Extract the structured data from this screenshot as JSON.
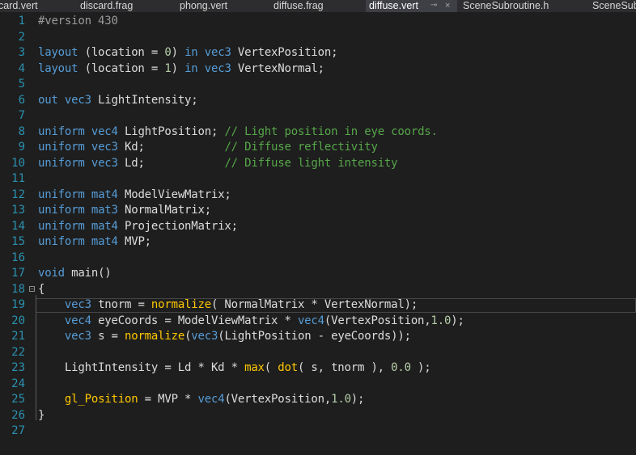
{
  "tabs": [
    {
      "label": "card.vert",
      "active": false
    },
    {
      "label": "discard.frag",
      "active": false
    },
    {
      "label": "phong.vert",
      "active": false
    },
    {
      "label": "diffuse.frag",
      "active": false
    },
    {
      "label": "diffuse.vert",
      "active": true,
      "pin": "⊸",
      "close": "×"
    },
    {
      "label": "SceneSubroutine.h",
      "active": false
    },
    {
      "label": "SceneSub",
      "active": false
    }
  ],
  "editor": {
    "current_line": 19,
    "lines": [
      {
        "n": "1",
        "tokens": [
          {
            "t": "#version 430",
            "c": "pp"
          }
        ]
      },
      {
        "n": "2",
        "tokens": []
      },
      {
        "n": "3",
        "tokens": [
          {
            "t": "layout",
            "c": "kw"
          },
          {
            "t": " (location = ",
            "c": "txt"
          },
          {
            "t": "0",
            "c": "num"
          },
          {
            "t": ") ",
            "c": "txt"
          },
          {
            "t": "in",
            "c": "kw"
          },
          {
            "t": " ",
            "c": "txt"
          },
          {
            "t": "vec3",
            "c": "kw"
          },
          {
            "t": " VertexPosition;",
            "c": "txt"
          }
        ]
      },
      {
        "n": "4",
        "tokens": [
          {
            "t": "layout",
            "c": "kw"
          },
          {
            "t": " (location = ",
            "c": "txt"
          },
          {
            "t": "1",
            "c": "num"
          },
          {
            "t": ") ",
            "c": "txt"
          },
          {
            "t": "in",
            "c": "kw"
          },
          {
            "t": " ",
            "c": "txt"
          },
          {
            "t": "vec3",
            "c": "kw"
          },
          {
            "t": " VertexNormal;",
            "c": "txt"
          }
        ]
      },
      {
        "n": "5",
        "tokens": []
      },
      {
        "n": "6",
        "tokens": [
          {
            "t": "out",
            "c": "kw"
          },
          {
            "t": " ",
            "c": "txt"
          },
          {
            "t": "vec3",
            "c": "kw"
          },
          {
            "t": " LightIntensity;",
            "c": "txt"
          }
        ]
      },
      {
        "n": "7",
        "tokens": []
      },
      {
        "n": "8",
        "tokens": [
          {
            "t": "uniform",
            "c": "kw"
          },
          {
            "t": " ",
            "c": "txt"
          },
          {
            "t": "vec4",
            "c": "kw"
          },
          {
            "t": " LightPosition; ",
            "c": "txt"
          },
          {
            "t": "// Light position in eye coords.",
            "c": "cm"
          }
        ]
      },
      {
        "n": "9",
        "tokens": [
          {
            "t": "uniform",
            "c": "kw"
          },
          {
            "t": " ",
            "c": "txt"
          },
          {
            "t": "vec3",
            "c": "kw"
          },
          {
            "t": " Kd;            ",
            "c": "txt"
          },
          {
            "t": "// Diffuse reflectivity",
            "c": "cm"
          }
        ]
      },
      {
        "n": "10",
        "tokens": [
          {
            "t": "uniform",
            "c": "kw"
          },
          {
            "t": " ",
            "c": "txt"
          },
          {
            "t": "vec3",
            "c": "kw"
          },
          {
            "t": " Ld;            ",
            "c": "txt"
          },
          {
            "t": "// Diffuse light intensity",
            "c": "cm"
          }
        ]
      },
      {
        "n": "11",
        "tokens": []
      },
      {
        "n": "12",
        "tokens": [
          {
            "t": "uniform",
            "c": "kw"
          },
          {
            "t": " ",
            "c": "txt"
          },
          {
            "t": "mat4",
            "c": "kw"
          },
          {
            "t": " ModelViewMatrix;",
            "c": "txt"
          }
        ]
      },
      {
        "n": "13",
        "tokens": [
          {
            "t": "uniform",
            "c": "kw"
          },
          {
            "t": " ",
            "c": "txt"
          },
          {
            "t": "mat3",
            "c": "kw"
          },
          {
            "t": " NormalMatrix;",
            "c": "txt"
          }
        ]
      },
      {
        "n": "14",
        "tokens": [
          {
            "t": "uniform",
            "c": "kw"
          },
          {
            "t": " ",
            "c": "txt"
          },
          {
            "t": "mat4",
            "c": "kw"
          },
          {
            "t": " ProjectionMatrix;",
            "c": "txt"
          }
        ]
      },
      {
        "n": "15",
        "tokens": [
          {
            "t": "uniform",
            "c": "kw"
          },
          {
            "t": " ",
            "c": "txt"
          },
          {
            "t": "mat4",
            "c": "kw"
          },
          {
            "t": " MVP;",
            "c": "txt"
          }
        ]
      },
      {
        "n": "16",
        "tokens": []
      },
      {
        "n": "17",
        "tokens": [
          {
            "t": "void",
            "c": "kw"
          },
          {
            "t": " main()",
            "c": "txt"
          }
        ]
      },
      {
        "n": "18",
        "tokens": [
          {
            "t": "{",
            "c": "txt"
          }
        ]
      },
      {
        "n": "19",
        "tokens": [
          {
            "t": "    ",
            "c": "txt"
          },
          {
            "t": "vec3",
            "c": "kw"
          },
          {
            "t": " tnorm = ",
            "c": "txt"
          },
          {
            "t": "normalize",
            "c": "fn"
          },
          {
            "t": "( NormalMatrix * VertexNormal);",
            "c": "txt"
          }
        ]
      },
      {
        "n": "20",
        "tokens": [
          {
            "t": "    ",
            "c": "txt"
          },
          {
            "t": "vec4",
            "c": "kw"
          },
          {
            "t": " eyeCoords = ModelViewMatrix * ",
            "c": "txt"
          },
          {
            "t": "vec4",
            "c": "kw"
          },
          {
            "t": "(VertexPosition,",
            "c": "txt"
          },
          {
            "t": "1.0",
            "c": "num"
          },
          {
            "t": ");",
            "c": "txt"
          }
        ]
      },
      {
        "n": "21",
        "tokens": [
          {
            "t": "    ",
            "c": "txt"
          },
          {
            "t": "vec3",
            "c": "kw"
          },
          {
            "t": " s = ",
            "c": "txt"
          },
          {
            "t": "normalize",
            "c": "fn"
          },
          {
            "t": "(",
            "c": "txt"
          },
          {
            "t": "vec3",
            "c": "kw"
          },
          {
            "t": "(LightPosition - eyeCoords));",
            "c": "txt"
          }
        ]
      },
      {
        "n": "22",
        "tokens": []
      },
      {
        "n": "23",
        "tokens": [
          {
            "t": "    LightIntensity = Ld * Kd * ",
            "c": "txt"
          },
          {
            "t": "max",
            "c": "fn"
          },
          {
            "t": "( ",
            "c": "txt"
          },
          {
            "t": "dot",
            "c": "fn"
          },
          {
            "t": "( s, tnorm ), ",
            "c": "txt"
          },
          {
            "t": "0.0",
            "c": "num"
          },
          {
            "t": " );",
            "c": "txt"
          }
        ]
      },
      {
        "n": "24",
        "tokens": []
      },
      {
        "n": "25",
        "tokens": [
          {
            "t": "    ",
            "c": "txt"
          },
          {
            "t": "gl_Position",
            "c": "fn"
          },
          {
            "t": " = MVP * ",
            "c": "txt"
          },
          {
            "t": "vec4",
            "c": "kw"
          },
          {
            "t": "(VertexPosition,",
            "c": "txt"
          },
          {
            "t": "1.0",
            "c": "num"
          },
          {
            "t": ");",
            "c": "txt"
          }
        ]
      },
      {
        "n": "26",
        "tokens": [
          {
            "t": "}",
            "c": "txt"
          }
        ]
      },
      {
        "n": "27",
        "tokens": []
      }
    ]
  },
  "colors": {
    "keyword": "#569cd6",
    "comment": "#57a64a",
    "function": "#ffc800",
    "number": "#b5cea8",
    "line_number": "#2b91af",
    "background": "#1e1e1e"
  },
  "icons": {
    "fold": "collapse-minus-icon",
    "pin": "pin-icon",
    "close": "close-icon"
  }
}
